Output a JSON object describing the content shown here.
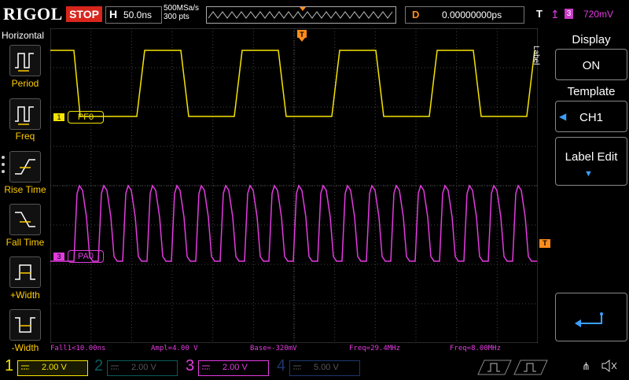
{
  "top": {
    "brand": "RIGOL",
    "run_state": "STOP",
    "timebase_label": "H",
    "timebase_value": "50.0ns",
    "sample_rate": "500MSa/s",
    "memory_depth": "300 pts",
    "delay_label": "D",
    "delay_value": "0.00000000ps",
    "trigger_label": "T",
    "trigger_source": "3",
    "trigger_level": "720mV"
  },
  "left_menu": {
    "title": "Horizontal",
    "items": [
      {
        "label": "Period",
        "icon": "period-icon"
      },
      {
        "label": "Freq",
        "icon": "freq-icon"
      },
      {
        "label": "Rise Time",
        "icon": "rise-time-icon"
      },
      {
        "label": "Fall Time",
        "icon": "fall-time-icon"
      },
      {
        "label": "+Width",
        "icon": "pos-width-icon"
      },
      {
        "label": "-Width",
        "icon": "neg-width-icon"
      }
    ]
  },
  "traces": {
    "ch1_marker": "1",
    "ch1_label": "PF0",
    "ch3_marker": "3",
    "ch3_label": "PA0",
    "trigger_marker": "T"
  },
  "right_menu": {
    "side_label": "Label",
    "display_title": "Display",
    "display_value": "ON",
    "template_title": "Template",
    "template_value": "CH1",
    "label_edit": "Label Edit"
  },
  "measurements": {
    "fall": "Fall1<10.00ns",
    "ampl": "Ampl=4.00 V",
    "base": "Base=-320mV",
    "freq1": "Freq=29.4MHz",
    "freq2": "Freq=8.00MHz"
  },
  "channels": [
    {
      "num": "1",
      "value": "2.00 V",
      "color": "#f5e400",
      "active": true
    },
    {
      "num": "2",
      "value": "2.00 V",
      "color": "#18b4b4",
      "active": false
    },
    {
      "num": "3",
      "value": "2.00 V",
      "color": "#e33be0",
      "active": true
    },
    {
      "num": "4",
      "value": "5.00 V",
      "color": "#3a6fd8",
      "active": false
    }
  ],
  "colors": {
    "ch1": "#f5e400",
    "ch3": "#e33be0",
    "trigger": "#ff8c1a",
    "stop": "#d8261c"
  }
}
